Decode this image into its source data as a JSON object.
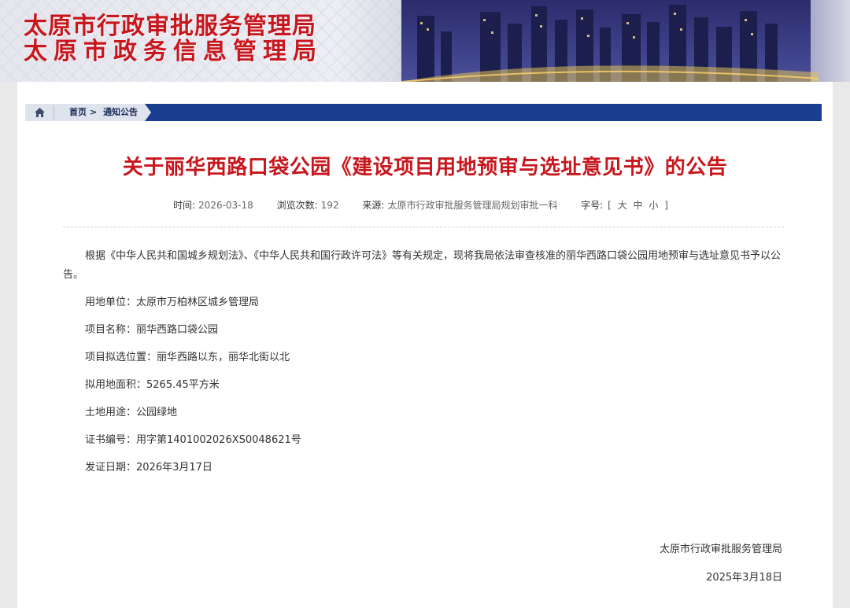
{
  "header": {
    "title_line1": "太原市行政审批服务管理局",
    "title_line2": "太原市政务信息管理局"
  },
  "breadcrumb": {
    "home_icon": "home-icon",
    "items": [
      "首页",
      "通知公告"
    ],
    "separator": ">"
  },
  "article": {
    "title": "关于丽华西路口袋公园《建设项目用地预审与选址意见书》的公告",
    "meta": {
      "time_label": "时间:",
      "time_value": "2026-03-18",
      "views_label": "浏览次数:",
      "views_value": "192",
      "source_label": "来源:",
      "source_value": "太原市行政审批服务管理局规划审批一科",
      "fontsize_label": "字号:",
      "fontsize_open": "[",
      "fontsize_large": "大",
      "fontsize_medium": "中",
      "fontsize_small": "小",
      "fontsize_close": "]"
    },
    "intro": "根据《中华人民共和国城乡规划法》、《中华人民共和国行政许可法》等有关规定，现将我局依法审查核准的丽华西路口袋公园用地预审与选址意见书予以公告。",
    "items": [
      "用地单位：太原市万柏林区城乡管理局",
      "项目名称：丽华西路口袋公园",
      "项目拟选位置：丽华西路以东，丽华北街以北",
      "拟用地面积：5265.45平方米",
      "土地用途：公园绿地",
      "证书编号：用字第1401002026XS0048621号",
      "发证日期：2026年3月17日"
    ],
    "signature_org": "太原市行政审批服务管理局",
    "signature_date": "2025年3月18日"
  },
  "colors": {
    "title_red": "#c8161d",
    "nav_blue": "#1a3e8f"
  }
}
